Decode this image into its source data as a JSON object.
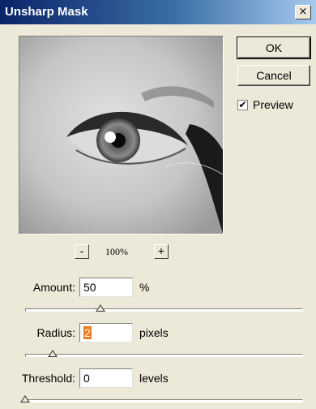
{
  "window": {
    "title": "Unsharp Mask",
    "close_glyph": "×"
  },
  "buttons": {
    "ok": "OK",
    "cancel": "Cancel"
  },
  "preview_checkbox": {
    "label": "Preview",
    "checked": true,
    "check_glyph": "✔"
  },
  "zoom": {
    "minus": "-",
    "level": "100%",
    "plus": "+"
  },
  "amount": {
    "label": "Amount:",
    "value": "50",
    "unit": "%",
    "slider_fraction": 0.27
  },
  "radius": {
    "label": "Radius:",
    "value": "2",
    "unit": "pixels",
    "slider_fraction": 0.1
  },
  "threshold": {
    "label": "Threshold:",
    "value": "0",
    "unit": "levels",
    "slider_fraction": 0.0
  },
  "colors": {
    "title_gradient_start": "#0a246a",
    "title_gradient_end": "#a6caf0",
    "selection": "#e87c1e",
    "dialog_bg": "#ece9d8"
  }
}
